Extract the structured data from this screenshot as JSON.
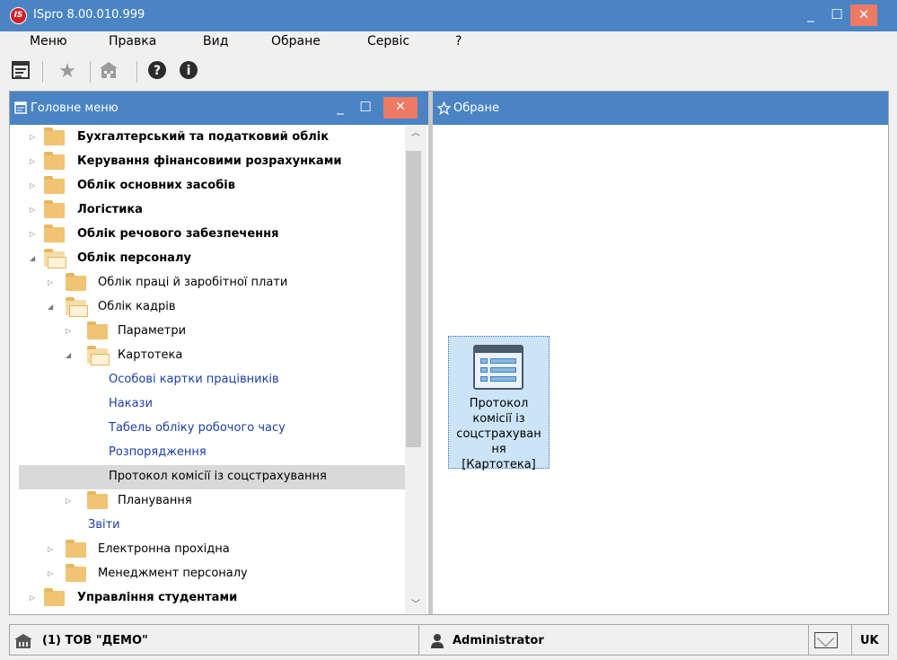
{
  "window": {
    "title": "ISpro 8.00.010.999",
    "logo_text": "IS"
  },
  "menubar": {
    "items": [
      "Меню",
      "Правка",
      "Вид",
      "Обране",
      "Сервіс",
      "?"
    ]
  },
  "toolbar": {
    "icons": [
      "main-menu-icon",
      "favorites-star-icon",
      "building-icon",
      "help-icon",
      "info-icon"
    ]
  },
  "left_panel": {
    "title": "Головне меню",
    "tree": [
      {
        "label": "Бухгалтерський та податковий облік",
        "level": 0,
        "state": "collapsed",
        "bold": true
      },
      {
        "label": "Керування фінансовими розрахунками",
        "level": 0,
        "state": "collapsed",
        "bold": true
      },
      {
        "label": "Облік основних засобів",
        "level": 0,
        "state": "collapsed",
        "bold": true
      },
      {
        "label": "Логістика",
        "level": 0,
        "state": "collapsed",
        "bold": true
      },
      {
        "label": "Облік речового забезпечення",
        "level": 0,
        "state": "collapsed",
        "bold": true
      },
      {
        "label": "Облік персоналу",
        "level": 0,
        "state": "expanded",
        "bold": true
      },
      {
        "label": "Облік праці й заробітної плати",
        "level": 1,
        "state": "collapsed"
      },
      {
        "label": "Облік кадрів",
        "level": 1,
        "state": "expanded"
      },
      {
        "label": "Параметри",
        "level": 2,
        "state": "collapsed"
      },
      {
        "label": "Картотека",
        "level": 2,
        "state": "expanded"
      },
      {
        "label": "Особові картки працівників",
        "level": 3,
        "state": "leaf"
      },
      {
        "label": "Накази",
        "level": 3,
        "state": "leaf"
      },
      {
        "label": "Табель обліку робочого часу",
        "level": 3,
        "state": "leaf"
      },
      {
        "label": "Розпорядження",
        "level": 3,
        "state": "leaf"
      },
      {
        "label": "Протокол комісії із соцстрахування",
        "level": 3,
        "state": "leaf",
        "selected": true
      },
      {
        "label": "Планування",
        "level": 2,
        "state": "collapsed"
      },
      {
        "label": "Звіти",
        "level": 2,
        "state": "leaf"
      },
      {
        "label": "Електронна прохідна",
        "level": 1,
        "state": "collapsed"
      },
      {
        "label": "Менеджмент персоналу",
        "level": 1,
        "state": "collapsed"
      },
      {
        "label": "Управління студентами",
        "level": 0,
        "state": "collapsed",
        "bold": true
      }
    ]
  },
  "right_panel": {
    "title": "Обране",
    "tile": {
      "lines": [
        "Протокол",
        "комісії із",
        "соцстрахуван",
        "ня",
        "[Картотека]"
      ]
    }
  },
  "statusbar": {
    "organization": "(1) ТОВ \"ДЕМО\"",
    "user": "Administrator",
    "language": "UK"
  },
  "colors": {
    "titlebar": "#4a84c4",
    "close_button": "#ee7a63",
    "selected_row": "#d9d9d9",
    "leaf_link": "#1a3fa6",
    "tile_background": "#cce4f7"
  }
}
